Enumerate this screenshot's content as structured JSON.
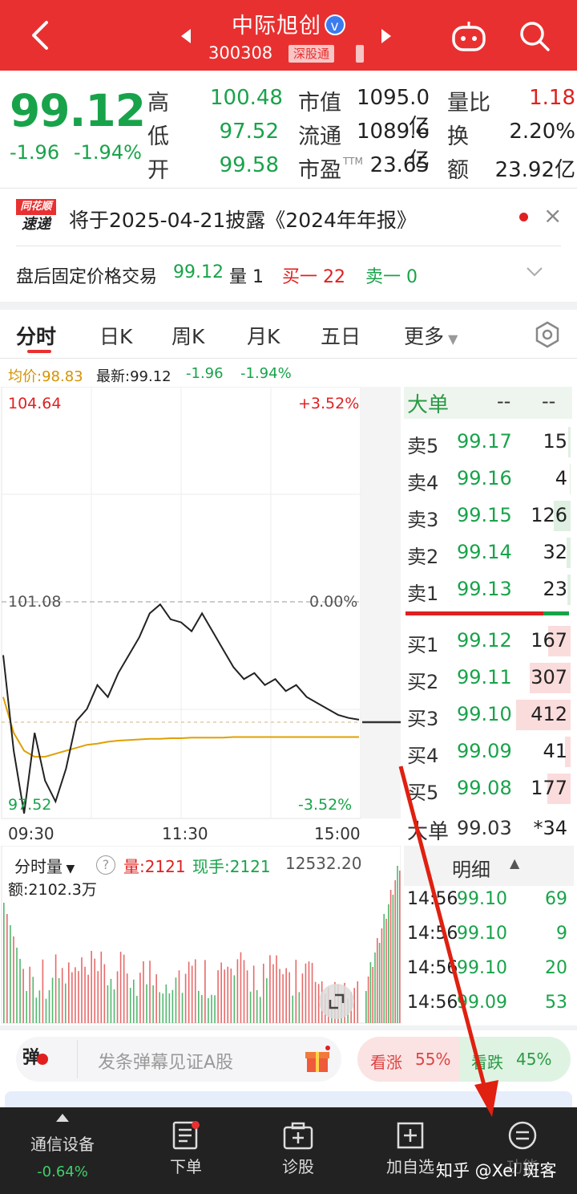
{
  "header": {
    "title": "中际旭创",
    "verified_mark": "v",
    "code": "300308",
    "exchange_tag": "深股通"
  },
  "quote": {
    "price": "99.12",
    "change": "-1.96",
    "change_pct": "-1.94%",
    "stats": [
      {
        "label": "高",
        "value": "100.48",
        "color": "green"
      },
      {
        "label": "低",
        "value": "97.52",
        "color": "green"
      },
      {
        "label": "开",
        "value": "99.58",
        "color": "green"
      },
      {
        "label": "市值",
        "value": "1095.0亿",
        "color": "dark"
      },
      {
        "label": "流通",
        "value": "1089.6亿",
        "color": "dark"
      },
      {
        "label": "市盈",
        "label_sup": "TTM",
        "value": "23.65",
        "color": "dark"
      },
      {
        "label": "量比",
        "value": "1.18",
        "color": "red"
      },
      {
        "label": "换",
        "value": "2.20%",
        "color": "dark"
      },
      {
        "label": "额",
        "value": "23.92亿",
        "color": "dark"
      }
    ]
  },
  "news": {
    "logo_top": "同花顺",
    "logo_bottom": "速递",
    "text": "将于2025-04-21披露《2024年年报》",
    "close": "×"
  },
  "after_hours": {
    "label": "盘后固定价格交易",
    "price": "99.12",
    "vol_label": "量 1",
    "buy1": "买一 22",
    "sell1": "卖一 0"
  },
  "tabs": [
    "分时",
    "日K",
    "周K",
    "月K",
    "五日",
    "更多"
  ],
  "info_row": {
    "avg": "均价:98.83",
    "latest": "最新:99.12",
    "change": "-1.96",
    "pct": "-1.94%"
  },
  "chart_labels": {
    "high": "104.64",
    "high_pct": "+3.52%",
    "mid": "101.08",
    "mid_pct": "0.00%",
    "low": "97.52",
    "low_pct": "-3.52%",
    "times": [
      "09:30",
      "11:30",
      "15:00"
    ]
  },
  "chart_data": {
    "type": "line",
    "ylim": [
      97.52,
      104.64
    ],
    "reference_price": 101.08,
    "series": [
      {
        "name": "最新",
        "values": [
          100.2,
          98.6,
          97.55,
          98.9,
          98.1,
          97.75,
          98.3,
          99.1,
          99.3,
          99.7,
          99.5,
          99.9,
          100.2,
          100.5,
          100.9,
          101.05,
          100.8,
          100.75,
          100.6,
          100.9,
          100.6,
          100.3,
          100.0,
          99.8,
          99.9,
          99.7,
          99.8,
          99.6,
          99.7,
          99.5,
          99.4,
          99.3,
          99.2,
          99.15,
          99.12
        ]
      },
      {
        "name": "均价",
        "values": [
          99.5,
          98.9,
          98.6,
          98.5,
          98.5,
          98.55,
          98.6,
          98.65,
          98.7,
          98.72,
          98.75,
          98.77,
          98.78,
          98.79,
          98.8,
          98.8,
          98.81,
          98.81,
          98.82,
          98.82,
          98.82,
          98.82,
          98.83,
          98.83,
          98.83,
          98.83,
          98.83,
          98.83,
          98.83,
          98.83,
          98.83,
          98.83,
          98.83,
          98.83,
          98.83
        ]
      }
    ],
    "colors": {
      "price": "#222222",
      "avg": "#e0a000"
    }
  },
  "order_book": {
    "big_label": "大单",
    "big_val1": "--",
    "big_val2": "--",
    "asks": [
      {
        "label": "卖5",
        "price": "99.17",
        "vol": "15",
        "bar": 0.04
      },
      {
        "label": "卖4",
        "price": "99.16",
        "vol": "4",
        "bar": 0.01
      },
      {
        "label": "卖3",
        "price": "99.15",
        "vol": "126",
        "bar": 0.31
      },
      {
        "label": "卖2",
        "price": "99.14",
        "vol": "32",
        "bar": 0.08
      },
      {
        "label": "卖1",
        "price": "99.13",
        "vol": "23",
        "bar": 0.06
      }
    ],
    "bids": [
      {
        "label": "买1",
        "price": "99.12",
        "vol": "167",
        "bar": 0.41
      },
      {
        "label": "买2",
        "price": "99.11",
        "vol": "307",
        "bar": 0.75
      },
      {
        "label": "买3",
        "price": "99.10",
        "vol": "412",
        "bar": 1.0
      },
      {
        "label": "买4",
        "price": "99.09",
        "vol": "41",
        "bar": 0.1
      },
      {
        "label": "买5",
        "price": "99.08",
        "vol": "177",
        "bar": 0.43
      }
    ],
    "big_bottom_label": "大单",
    "big_bottom_price": "99.03",
    "big_bottom_vol": "*34"
  },
  "volume_panel": {
    "selector": "分时量",
    "help": "?",
    "vol": "量:2121",
    "hand": "现手:2121",
    "max": "12532.20",
    "amount": "额:2102.3万"
  },
  "detail": {
    "header": "明细",
    "rows": [
      {
        "time": "14:56",
        "price": "99.10",
        "vol": "69"
      },
      {
        "time": "14:56",
        "price": "99.10",
        "vol": "9"
      },
      {
        "time": "14:56",
        "price": "99.10",
        "vol": "20"
      },
      {
        "time": "14:56",
        "price": "99.09",
        "vol": "53"
      }
    ]
  },
  "danmaku": {
    "button": "弹",
    "placeholder": "发条弹幕见证A股",
    "bullish": "看涨",
    "bullish_pct": "55%",
    "bearish": "看跌",
    "bearish_pct": "45%"
  },
  "bottom_bar": {
    "sector": "通信设备",
    "sector_pct": "-0.64%",
    "order": "下单",
    "diagnose": "诊股",
    "add_watch": "加自选",
    "features": "功能"
  },
  "watermark": "知乎 @Xel 斑客"
}
